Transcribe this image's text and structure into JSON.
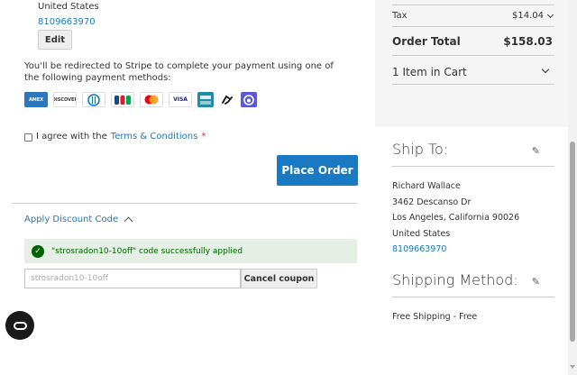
{
  "shipping_address_top": {
    "country": "United States",
    "phone": "8109663970",
    "edit_label": "Edit"
  },
  "payment": {
    "redirect_text": "You'll be redirected to Stripe to complete your payment using one of the following payment methods:",
    "methods": [
      {
        "name": "amex-icon",
        "label": "AMEX"
      },
      {
        "name": "discover-icon",
        "label": "DISCOVER"
      },
      {
        "name": "diners-icon",
        "label": ""
      },
      {
        "name": "jcb-icon",
        "label": ""
      },
      {
        "name": "mastercard-icon",
        "label": ""
      },
      {
        "name": "visa-icon",
        "label": "VISA"
      },
      {
        "name": "cartes-bancaires-icon",
        "label": ""
      },
      {
        "name": "link-icon",
        "label": ""
      },
      {
        "name": "other-wallet-icon",
        "label": ""
      }
    ]
  },
  "agreement": {
    "prefix": "I agree with the",
    "link": "Terms & Conditions",
    "required_mark": "*"
  },
  "place_order_label": "Place Order",
  "discount": {
    "title": "Apply Discount Code",
    "success_message": "\"strosradon10-10off\" code successfully applied",
    "input_value": "strosradon10-10off",
    "cancel_label": "Cancel coupon"
  },
  "summary": {
    "tax_label": "Tax",
    "tax_value": "$14.04",
    "order_total_label": "Order Total",
    "order_total_value": "$158.03",
    "items_in_cart": "1 Item in Cart"
  },
  "ship_to": {
    "title": "Ship To:",
    "name": "Richard Wallace",
    "street": "3462 Descanso Dr",
    "city_line": "Los Angeles, California 90026",
    "country": "United States",
    "phone": "8109663970"
  },
  "shipping_method": {
    "title": "Shipping Method:",
    "value": "Free Shipping - Free"
  },
  "colors": {
    "primary": "#1979c3",
    "success_bg": "#e5efe5",
    "success_text": "#006400",
    "summary_bg": "#f5f5f5"
  }
}
